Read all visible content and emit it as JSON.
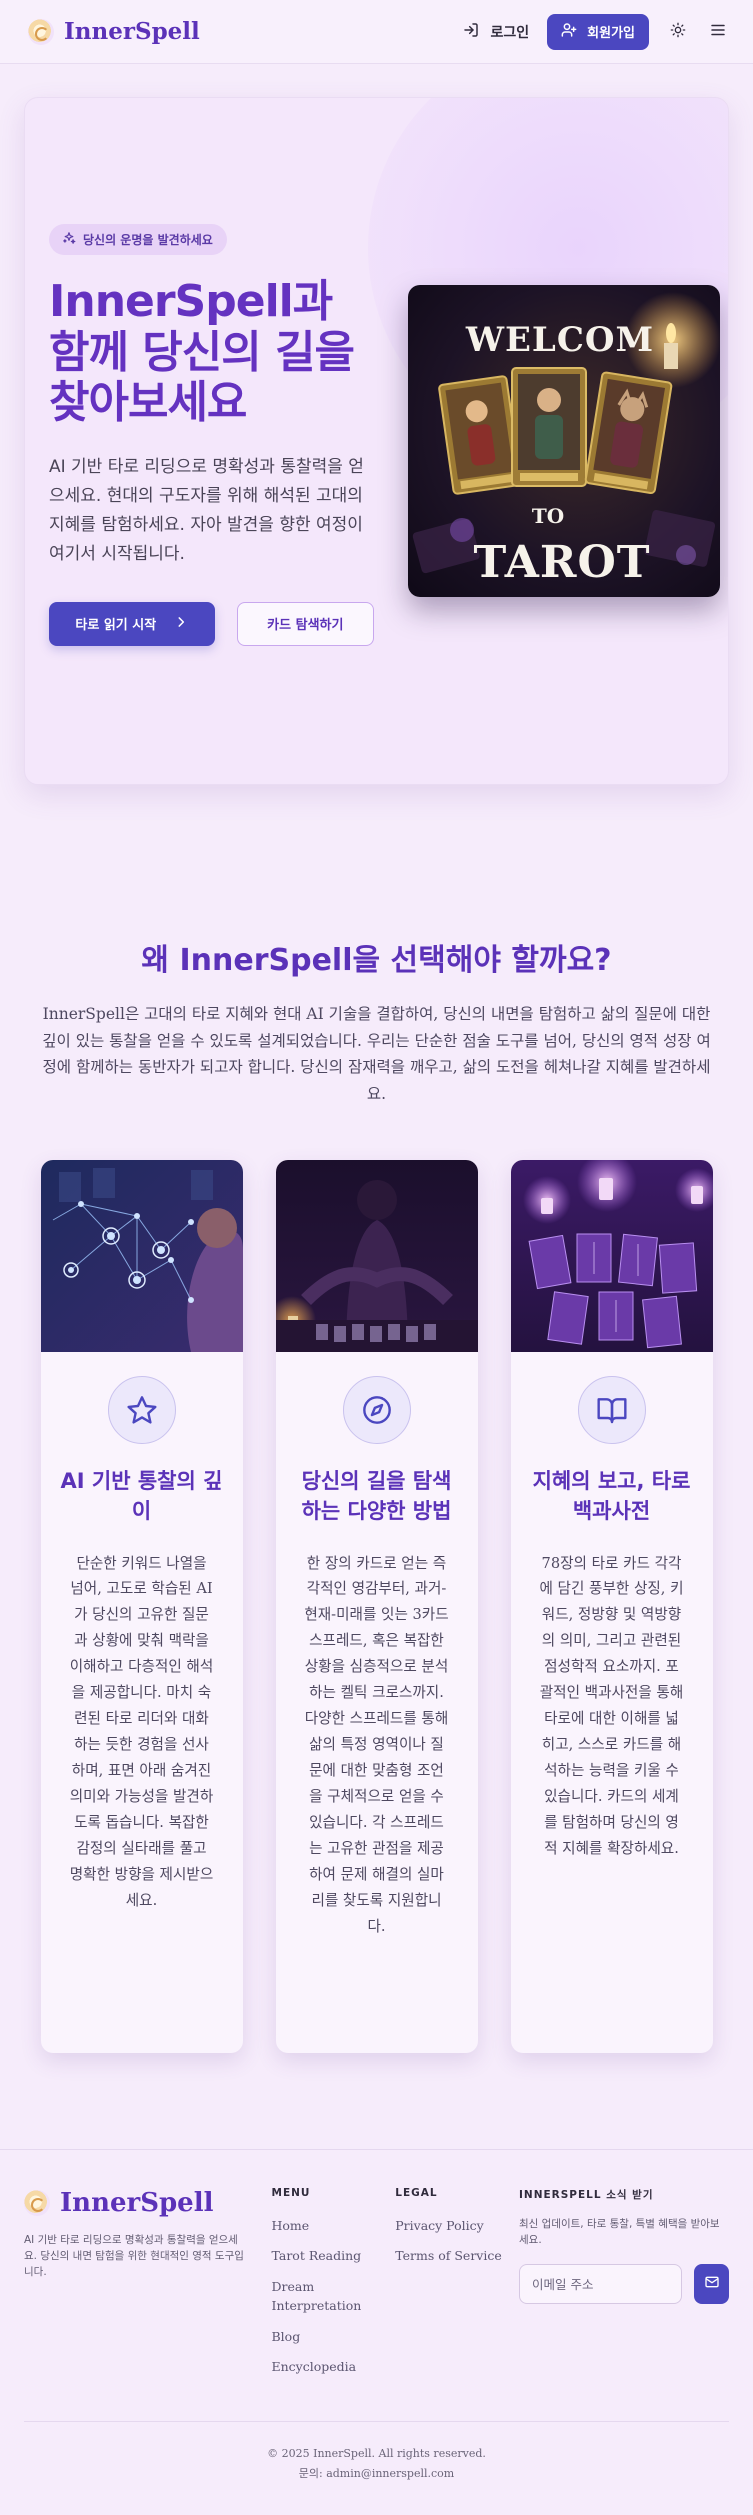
{
  "header": {
    "brand": "InnerSpell",
    "login_label": "로그인",
    "signup_label": "회원가입",
    "icons": [
      "log-in-icon",
      "user-plus-icon",
      "sun-icon",
      "menu-icon"
    ]
  },
  "hero": {
    "pill": "당신의 운명을 발견하세요",
    "title": "InnerSpell과 함께 당신의 길을 찾아보세요",
    "description": "AI 기반 타로 리딩으로 명확성과 통찰력을 얻으세요. 현대의 구도자를 위해 해석된 고대의 지혜를 탐험하세요. 자아 발견을 향한 여정이 여기서 시작됩니다.",
    "primary_button": "타로 읽기 시작",
    "secondary_button": "카드 탐색하기",
    "image_text_top": "WELCOM",
    "image_text_middle": "TO",
    "image_text_bottom": "TAROT"
  },
  "why": {
    "title": "왜 InnerSpell을 선택해야 할까요?",
    "description": "InnerSpell은 고대의 타로 지혜와 현대 AI 기술을 결합하여, 당신의 내면을 탐험하고 삶의 질문에 대한 깊이 있는 통찰을 얻을 수 있도록 설계되었습니다. 우리는 단순한 점술 도구를 넘어, 당신의 영적 성장 여정에 함께하는 동반자가 되고자 합니다. 당신의 잠재력을 깨우고, 삶의 도전을 헤쳐나갈 지혜를 발견하세요.",
    "cards": [
      {
        "icon": "star-icon",
        "title": "AI 기반 통찰의 깊이",
        "text": "단순한 키워드 나열을 넘어, 고도로 학습된 AI가 당신의 고유한 질문과 상황에 맞춰 맥락을 이해하고 다층적인 해석을 제공합니다. 마치 숙련된 타로 리더와 대화하는 듯한 경험을 선사하며, 표면 아래 숨겨진 의미와 가능성을 발견하도록 돕습니다. 복잡한 감정의 실타래를 풀고 명확한 방향을 제시받으세요."
      },
      {
        "icon": "compass-icon",
        "title": "당신의 길을 탐색하는 다양한 방법",
        "text": "한 장의 카드로 얻는 즉각적인 영감부터, 과거-현재-미래를 잇는 3카드 스프레드, 혹은 복잡한 상황을 심층적으로 분석하는 켈틱 크로스까지. 다양한 스프레드를 통해 삶의 특정 영역이나 질문에 대한 맞춤형 조언을 구체적으로 얻을 수 있습니다. 각 스프레드는 고유한 관점을 제공하여 문제 해결의 실마리를 찾도록 지원합니다."
      },
      {
        "icon": "book-open-icon",
        "title": "지혜의 보고, 타로 백과사전",
        "text": "78장의 타로 카드 각각에 담긴 풍부한 상징, 키워드, 정방향 및 역방향의 의미, 그리고 관련된 점성학적 요소까지. 포괄적인 백과사전을 통해 타로에 대한 이해를 넓히고, 스스로 카드를 해석하는 능력을 키울 수 있습니다. 카드의 세계를 탐험하며 당신의 영적 지혜를 확장하세요."
      }
    ]
  },
  "footer": {
    "brand": "InnerSpell",
    "description": "AI 기반 타로 리딩으로 명확성과 통찰력을 얻으세요. 당신의 내면 탐험을 위한 현대적인 영적 도구입니다.",
    "menu_title": "MENU",
    "menu_links": [
      "Home",
      "Tarot Reading",
      "Dream Interpretation",
      "Blog",
      "Encyclopedia"
    ],
    "legal_title": "LEGAL",
    "legal_links": [
      "Privacy Policy",
      "Terms of Service"
    ],
    "newsletter_title": "INNERSPELL 소식 받기",
    "newsletter_text": "최신 업데이트, 타로 통찰, 특별 혜택을 받아보세요.",
    "email_placeholder": "이메일 주소",
    "copyright": "© 2025 InnerSpell. All rights reserved.",
    "contact": "문의: admin@innerspell.com"
  },
  "colors": {
    "brand_purple": "#5b32b8",
    "primary_button": "#4b47c0",
    "background": "#f6ecfb"
  }
}
